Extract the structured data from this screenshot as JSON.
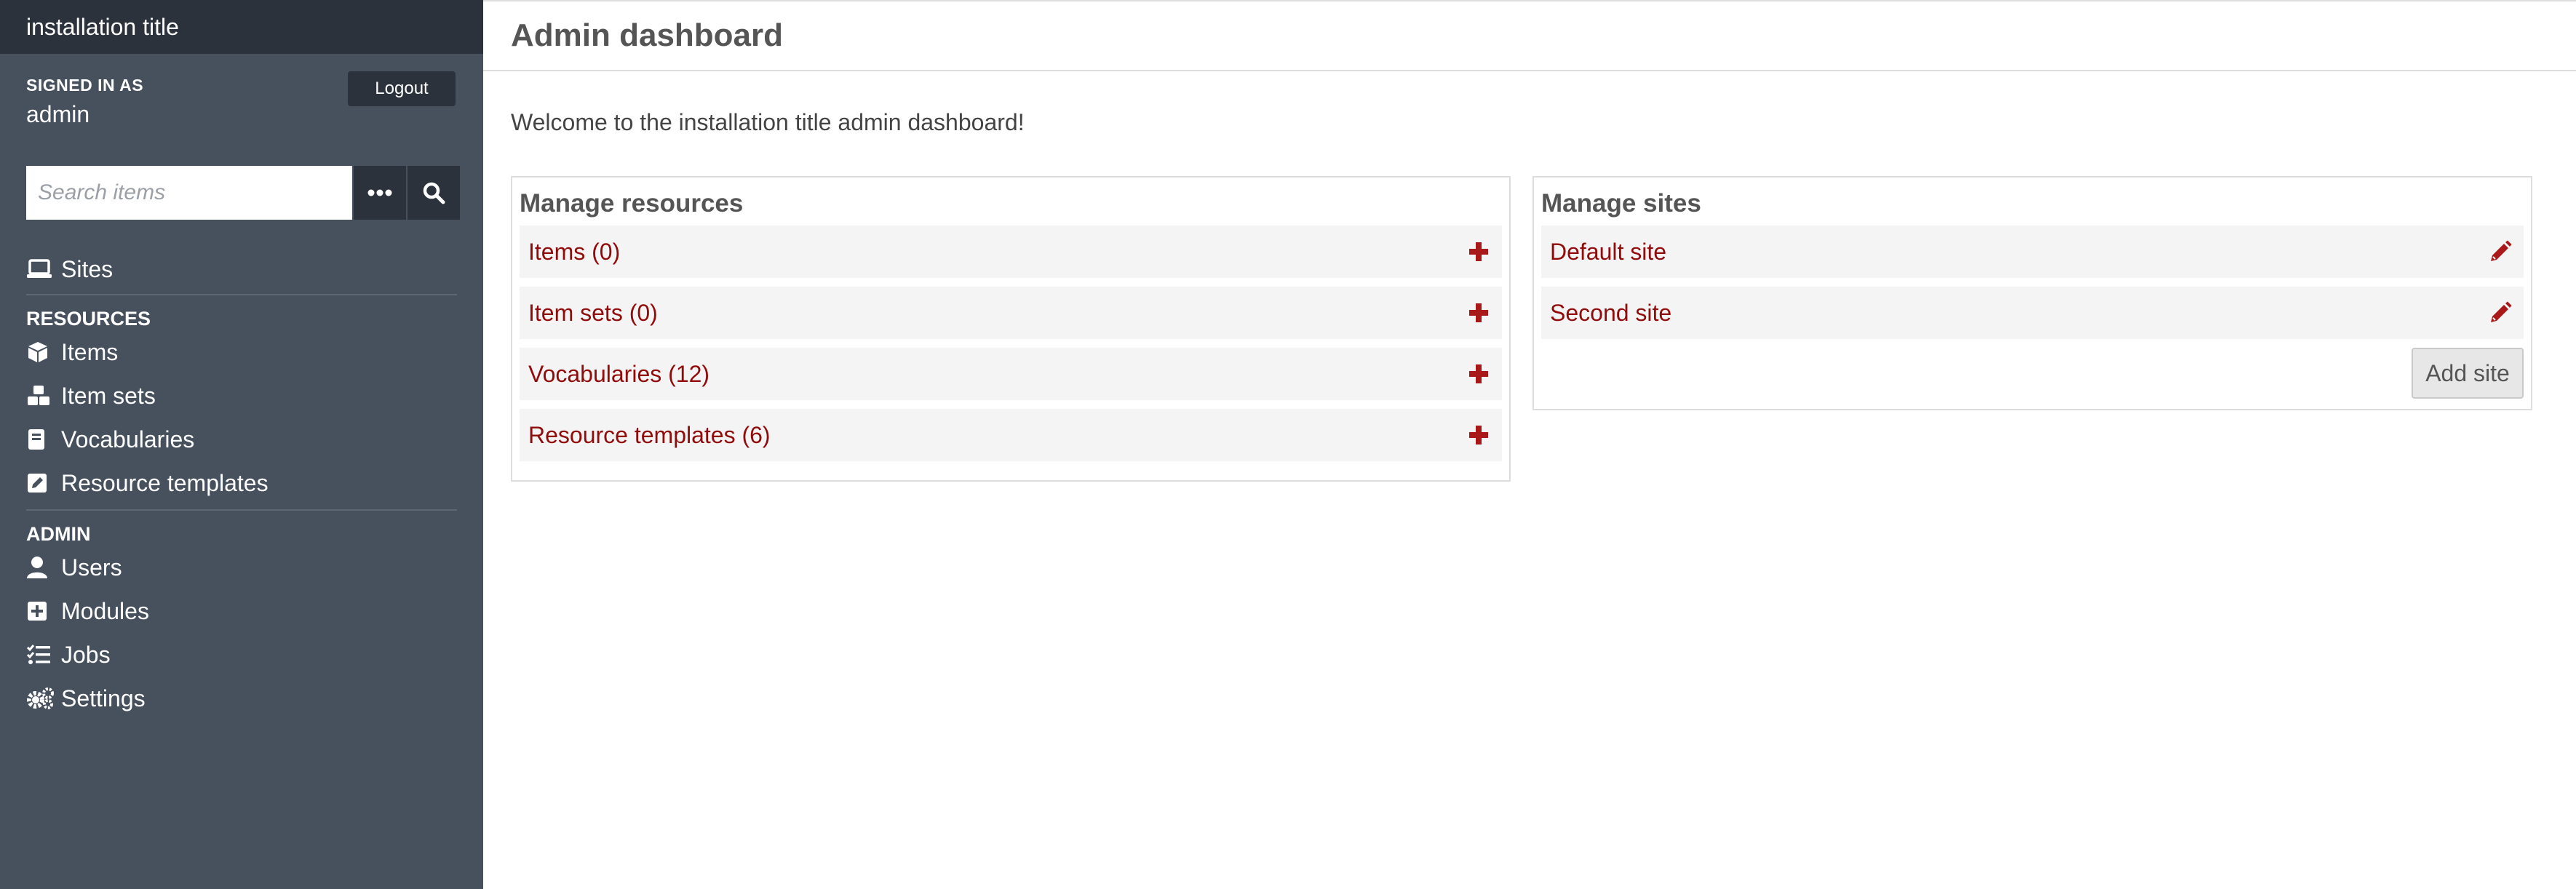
{
  "sidebar": {
    "installation_title": "installation title",
    "signed_in_label": "SIGNED IN AS",
    "username": "admin",
    "logout_label": "Logout",
    "search": {
      "placeholder": "Search items"
    },
    "sites_label": "Sites",
    "resources_heading": "RESOURCES",
    "resources": [
      {
        "label": "Items",
        "icon": "cube-icon"
      },
      {
        "label": "Item sets",
        "icon": "cubes-icon"
      },
      {
        "label": "Vocabularies",
        "icon": "book-icon"
      },
      {
        "label": "Resource templates",
        "icon": "edit-square-icon"
      }
    ],
    "admin_heading": "ADMIN",
    "admin": [
      {
        "label": "Users",
        "icon": "user-icon"
      },
      {
        "label": "Modules",
        "icon": "plus-square-icon"
      },
      {
        "label": "Jobs",
        "icon": "tasks-icon"
      },
      {
        "label": "Settings",
        "icon": "cogs-icon"
      }
    ]
  },
  "main": {
    "page_title": "Admin dashboard",
    "welcome": "Welcome to the installation title admin dashboard!",
    "manage_resources": {
      "title": "Manage resources",
      "rows": [
        {
          "label": "Items (0)"
        },
        {
          "label": "Item sets (0)"
        },
        {
          "label": "Vocabularies (12)"
        },
        {
          "label": "Resource templates (6)"
        }
      ]
    },
    "manage_sites": {
      "title": "Manage sites",
      "rows": [
        {
          "label": "Default site"
        },
        {
          "label": "Second site"
        }
      ],
      "add_site_label": "Add site"
    }
  },
  "colors": {
    "sidebar_bg": "#47505d",
    "sidebar_dark": "#2c323b",
    "link": "#920b0b",
    "accent_icon": "#a91919"
  }
}
